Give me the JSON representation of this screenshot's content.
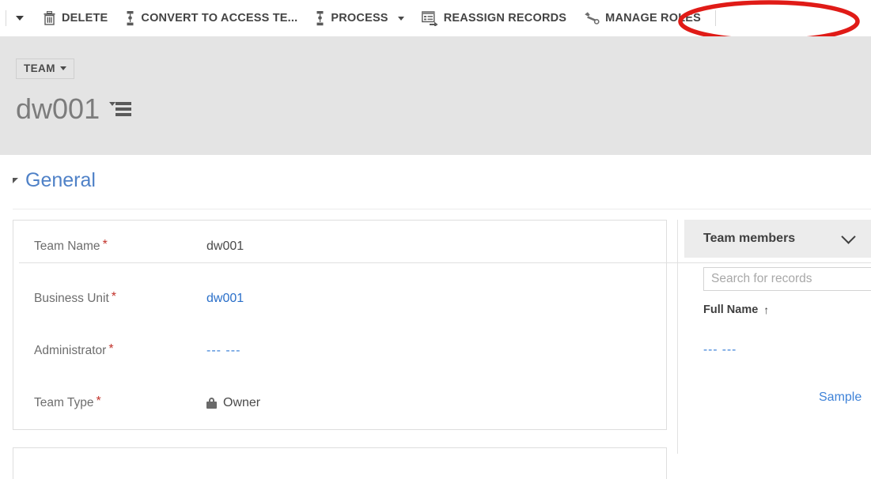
{
  "command_bar": {
    "overflow_caret_icon": "chevron-down-icon",
    "buttons": [
      {
        "label": "DELETE",
        "icon": "trash-icon",
        "has_caret": false
      },
      {
        "label": "CONVERT TO ACCESS TE...",
        "icon": "team-convert-icon",
        "has_caret": false
      },
      {
        "label": "PROCESS",
        "icon": "process-icon",
        "has_caret": true
      },
      {
        "label": "REASSIGN RECORDS",
        "icon": "reassign-records-icon",
        "has_caret": false
      },
      {
        "label": "MANAGE ROLES",
        "icon": "wrench-icon",
        "has_caret": false
      }
    ]
  },
  "title_band": {
    "entity_chip": {
      "label": "TEAM",
      "caret_icon": "chevron-down-icon"
    },
    "record_name": "dw001",
    "record_menu_icon": "sort-menu-icon"
  },
  "section": {
    "collapse_icon": "triangle-collapse-icon",
    "title": "General"
  },
  "form": {
    "fields": [
      {
        "label": "Team Name",
        "required": "*",
        "value": "dw001",
        "style": "text"
      },
      {
        "label": "Business Unit",
        "required": "*",
        "value": "dw001",
        "style": "link"
      },
      {
        "label": "Administrator",
        "required": "*",
        "value": "--- ---",
        "style": "dash"
      },
      {
        "label": "Team Type",
        "required": "*",
        "value": "Owner",
        "style": "locked",
        "icon": "lock-icon"
      }
    ]
  },
  "side_panel": {
    "title": "Team members",
    "collapse_icon": "chevron-down-icon",
    "search": {
      "placeholder": "Search for records",
      "value": ""
    },
    "column_header": {
      "label": "Full Name",
      "sort_icon": "↑"
    },
    "rows": [
      {
        "value": "--- ---"
      },
      {
        "value": "Sample"
      }
    ]
  },
  "annotation": {
    "shape": "ellipse-highlight",
    "color": "#e01b17",
    "target_label": "MANAGE ROLES"
  },
  "colors": {
    "command_text": "#444444",
    "title_band_bg": "#e4e4e4",
    "record_title": "#7c7c7c",
    "section_title": "#4f81c7",
    "link": "#2a6fc9",
    "required_asterisk": "#c2332b",
    "annotation_red": "#e01b17"
  }
}
